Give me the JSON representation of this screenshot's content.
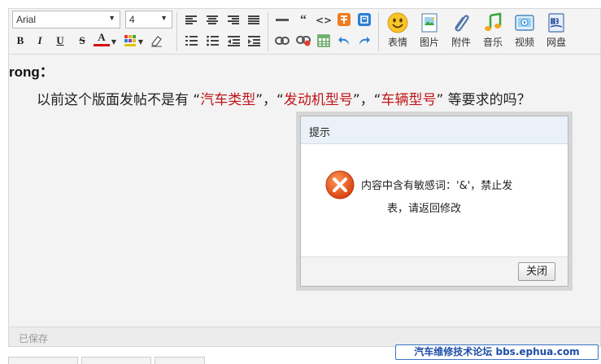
{
  "toolbar": {
    "font_family": "Arial",
    "font_size": "4",
    "buttons": {
      "bold": "B",
      "italic": "I",
      "underline": "U",
      "strike": "S",
      "font_color": "A",
      "quote": "“",
      "code": "<>"
    },
    "big_buttons": [
      {
        "label": "表情",
        "icon": "smiley-icon"
      },
      {
        "label": "图片",
        "icon": "image-icon"
      },
      {
        "label": "附件",
        "icon": "paperclip-icon"
      },
      {
        "label": "音乐",
        "icon": "music-icon"
      },
      {
        "label": "视频",
        "icon": "video-icon"
      },
      {
        "label": "网盘",
        "icon": "netdisk-icon"
      }
    ],
    "colors": {
      "accent_red": "#e63c2f",
      "icon_blue": "#2d7fd3"
    }
  },
  "editor": {
    "author": "rong：",
    "post": {
      "before": "以前这个版面发帖不是有 “",
      "term1": "汽车类型",
      "mid1": "”，“",
      "term2": "发动机型号",
      "mid2": "”，“",
      "term3": "车辆型号",
      "after": "” 等要求的吗？"
    },
    "highlight_color": "#c0141a"
  },
  "status": {
    "saved": "已保存"
  },
  "dialog": {
    "title": "提示",
    "message_line1": "内容中含有敏感词：'&'，禁止发",
    "message_line2": "表，请返回修改",
    "close_label": "关闭",
    "icon": "error-x-icon",
    "icon_color": "#e8531f"
  },
  "watermark": "汽车维修技术论坛 bbs.ephua.com"
}
